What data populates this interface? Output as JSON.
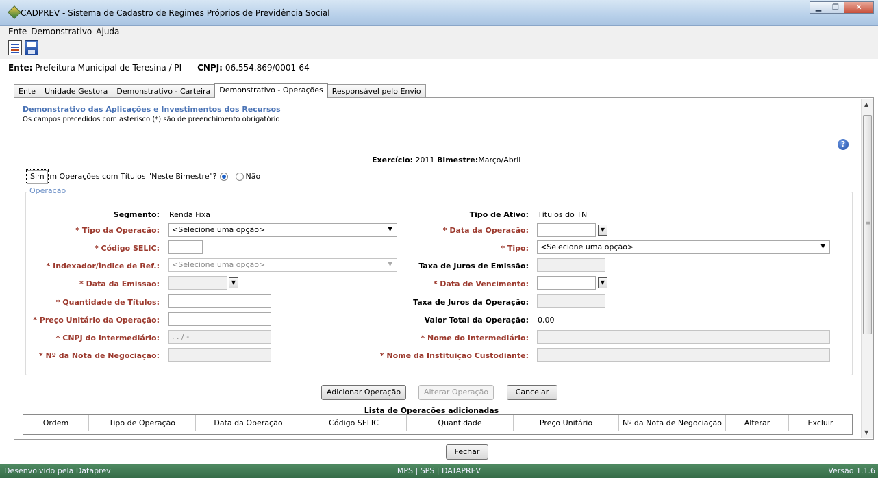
{
  "window": {
    "title": "CADPREV - Sistema de Cadastro de Regimes Próprios de Previdência Social"
  },
  "menu": {
    "items": [
      "Ente",
      "Demonstrativo",
      "Ajuda"
    ]
  },
  "ente": {
    "label": "Ente:",
    "value": "Prefeitura Municipal de Teresina / PI",
    "cnpj_label": "CNPJ:",
    "cnpj_value": "06.554.869/0001-64"
  },
  "tabs": [
    "Ente",
    "Unidade Gestora",
    "Demonstrativo - Carteira",
    "Demonstrativo - Operações",
    "Responsável pelo Envio"
  ],
  "active_tab": "Demonstrativo - Operações",
  "section": {
    "title": "Demonstrativo das Aplicações e Investimentos dos Recursos",
    "note": "Os campos precedidos com asterisco (*) são de preenchimento obrigatório",
    "exercicio_label": "Exercício:",
    "exercicio_value": "2011",
    "bimestre_label": "Bimestre:",
    "bimestre_value": "Março/Abril"
  },
  "question": {
    "text": "Existem Operações com Títulos \"Neste Bimestre\"?",
    "yes": "Sim",
    "no": "Não",
    "selected": "Sim"
  },
  "operacao": {
    "legend": "Operação",
    "segmento_label": "Segmento:",
    "segmento_value": "Renda Fixa",
    "tipo_ativo_label": "Tipo de Ativo:",
    "tipo_ativo_value": "Títulos do TN",
    "tipo_operacao_label": "* Tipo da Operação:",
    "tipo_operacao_value": "<Selecione uma opção>",
    "data_operacao_label": "* Data da Operação:",
    "codigo_selic_label": "* Código SELIC:",
    "tipo_label": "* Tipo:",
    "tipo_value": "<Selecione uma opção>",
    "indexador_label": "* Indexador/Índice de Ref.:",
    "indexador_value": "<Selecione uma opção>",
    "taxa_emissao_label": "Taxa de Juros de Emissão:",
    "data_emissao_label": "* Data da Emissão:",
    "data_vencimento_label": "* Data de Vencimento:",
    "quantidade_label": "* Quantidade de Títulos:",
    "taxa_operacao_label": "Taxa de Juros da Operação:",
    "preco_label": "* Preço Unitário da Operação:",
    "valor_total_label": "Valor Total da Operação:",
    "valor_total_value": "0,00",
    "cnpj_intermediario_label": "* CNPJ do Intermediário:",
    "cnpj_intermediario_placeholder": " .   .   /    -",
    "nome_intermediario_label": "* Nome do Intermediário:",
    "nota_label": "* Nº da Nota de Negociação:",
    "custodiante_label": "* Nome da Instituição Custodiante:"
  },
  "buttons": {
    "adicionar": "Adicionar Operação",
    "alterar": "Alterar Operação",
    "cancelar": "Cancelar",
    "fechar": "Fechar"
  },
  "list": {
    "title": "Lista de Operações adicionadas",
    "columns": [
      "Ordem",
      "Tipo de Operação",
      "Data da Operação",
      "Código SELIC",
      "Quantidade",
      "Preço Unitário",
      "Nº da Nota de Negociação",
      "Alterar",
      "Excluir"
    ]
  },
  "status": {
    "left": "Desenvolvido pela Dataprev",
    "center": "MPS | SPS | DATAPREV",
    "right": "Versão 1.1.6"
  },
  "icons": [
    "app-icon",
    "document-icon",
    "save-icon",
    "help-icon",
    "calendar-dropdown-icon",
    "chevron-down-icon"
  ],
  "colors": {
    "title_bar": "#b9d1ea",
    "section_title": "#4a73b5",
    "required_label": "#9c3a2e",
    "status_bar": "#3f7a52"
  }
}
